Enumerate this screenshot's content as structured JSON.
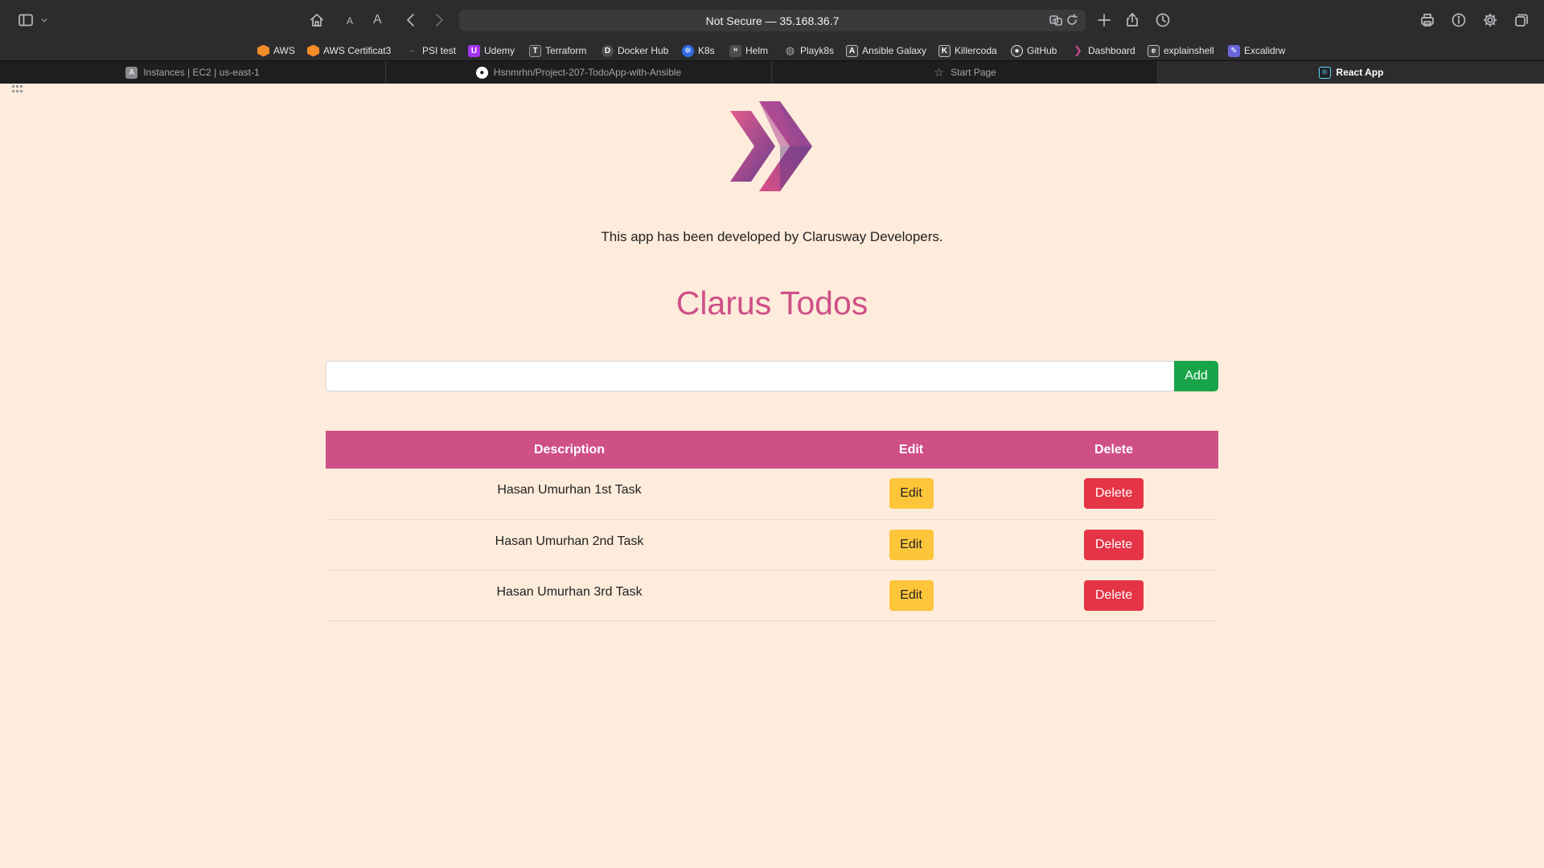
{
  "browser": {
    "address": "Not Secure — 35.168.36.7",
    "text_size_small": "A",
    "text_size_large": "A",
    "bookmarks": [
      {
        "label": "AWS",
        "icon": "aws-icon",
        "color": "#f28b2a"
      },
      {
        "label": "AWS Certificat3",
        "icon": "aws-icon",
        "color": "#f28b2a"
      },
      {
        "label": "PSI test",
        "icon": "dash-icon",
        "color": "#555555"
      },
      {
        "label": "Udemy",
        "icon": "udemy-icon",
        "color": "#a435f0"
      },
      {
        "label": "Terraform",
        "icon": "terraform-icon",
        "color": "#3d3d3d"
      },
      {
        "label": "Docker Hub",
        "icon": "docker-icon",
        "color": "#4d4d4d"
      },
      {
        "label": "K8s",
        "icon": "kubernetes-icon",
        "color": "#326ce5"
      },
      {
        "label": "Helm",
        "icon": "helm-icon",
        "color": "#4d4d4d"
      },
      {
        "label": "Playk8s",
        "icon": "globe-icon",
        "color": "#4d4d4d"
      },
      {
        "label": "Ansible Galaxy",
        "icon": "ansible-icon",
        "color": "#3d3d3d"
      },
      {
        "label": "Killercoda",
        "icon": "killercoda-icon",
        "color": "#3d3d3d"
      },
      {
        "label": "GitHub",
        "icon": "github-icon",
        "color": "#3d3d3d"
      },
      {
        "label": "Dashboard",
        "icon": "dashboard-icon",
        "color": "#c24a8a"
      },
      {
        "label": "explainshell",
        "icon": "explainshell-icon",
        "color": "#3d3d3d"
      },
      {
        "label": "Excalidrw",
        "icon": "excalidraw-icon",
        "color": "#6965db"
      }
    ],
    "tabs": [
      {
        "label": "Instances | EC2 | us-east-1",
        "icon": "aws-console-icon",
        "active": false
      },
      {
        "label": "Hsnmrhn/Project-207-TodoApp-with-Ansible",
        "icon": "github-icon",
        "active": false
      },
      {
        "label": "Start Page",
        "icon": "star-icon",
        "active": false
      },
      {
        "label": "React App",
        "icon": "react-icon",
        "active": true
      }
    ]
  },
  "page": {
    "credit": "This app has been developed by Clarusway Developers.",
    "title": "Clarus Todos",
    "input": {
      "value": "",
      "placeholder": ""
    },
    "add_label": "Add",
    "table": {
      "headers": [
        "Description",
        "Edit",
        "Delete"
      ],
      "rows": [
        {
          "description": "Hasan Umurhan 1st Task",
          "edit": "Edit",
          "delete": "Delete"
        },
        {
          "description": "Hasan Umurhan 2nd Task",
          "edit": "Edit",
          "delete": "Delete"
        },
        {
          "description": "Hasan Umurhan 3rd Task",
          "edit": "Edit",
          "delete": "Delete"
        }
      ]
    }
  },
  "colors": {
    "page_background": "#fdebdb",
    "accent": "#cf4f87",
    "add_button": "#1aa44a",
    "edit_button": "#fdc53a",
    "delete_button": "#e53446"
  }
}
